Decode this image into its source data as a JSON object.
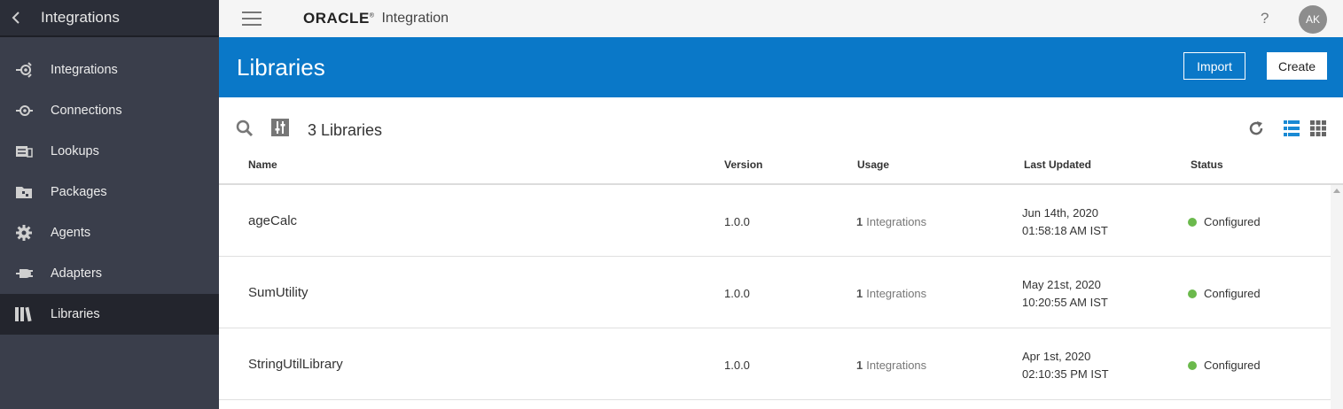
{
  "sidebar": {
    "title": "Integrations",
    "items": [
      {
        "label": "Integrations",
        "icon": "integrations-icon"
      },
      {
        "label": "Connections",
        "icon": "connections-icon"
      },
      {
        "label": "Lookups",
        "icon": "lookups-icon"
      },
      {
        "label": "Packages",
        "icon": "packages-icon"
      },
      {
        "label": "Agents",
        "icon": "gear-icon"
      },
      {
        "label": "Adapters",
        "icon": "plug-icon"
      },
      {
        "label": "Libraries",
        "icon": "libraries-icon",
        "active": true
      }
    ]
  },
  "topbar": {
    "brand": "ORACLE",
    "brand_mark": "®",
    "product": "Integration",
    "help": "?",
    "avatar": "AK"
  },
  "banner": {
    "title": "Libraries",
    "import_label": "Import",
    "create_label": "Create"
  },
  "toolbar": {
    "count_label": "3 Libraries"
  },
  "table": {
    "columns": [
      "Name",
      "Version",
      "Usage",
      "Last Updated",
      "Status"
    ],
    "rows": [
      {
        "name": "ageCalc",
        "version": "1.0.0",
        "usage_count": "1",
        "usage_label": "Integrations",
        "date": "Jun 14th, 2020",
        "time": "01:58:18 AM IST",
        "status": "Configured"
      },
      {
        "name": "SumUtility",
        "version": "1.0.0",
        "usage_count": "1",
        "usage_label": "Integrations",
        "date": "May 21st, 2020",
        "time": "10:20:55 AM IST",
        "status": "Configured"
      },
      {
        "name": "StringUtilLibrary",
        "version": "1.0.0",
        "usage_count": "1",
        "usage_label": "Integrations",
        "date": "Apr 1st, 2020",
        "time": "02:10:35 PM IST",
        "status": "Configured"
      }
    ]
  },
  "colors": {
    "sidebar_bg": "#3a3e4b",
    "banner_bg": "#0a78c8",
    "status_ok": "#6bb94c",
    "view_active": "#1a8ad4"
  }
}
